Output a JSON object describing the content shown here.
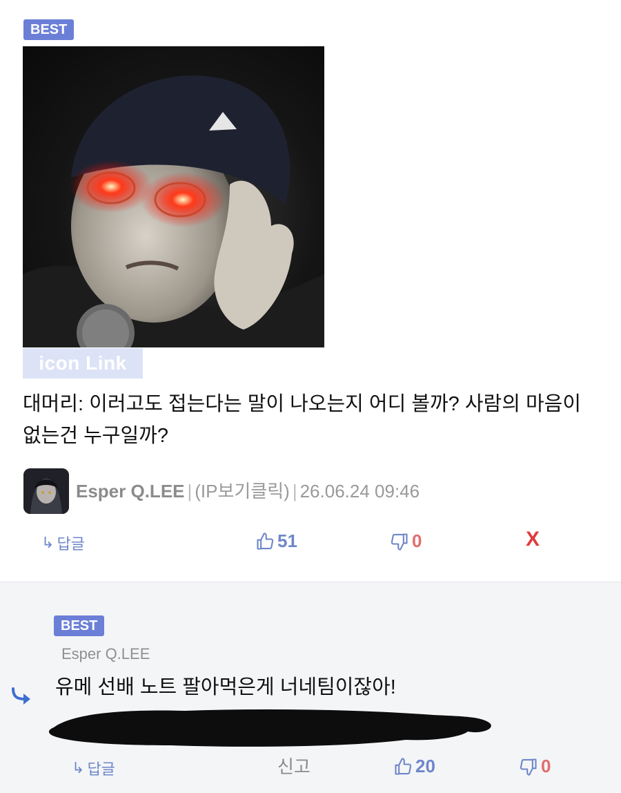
{
  "comment": {
    "badge": "BEST",
    "image_caption": "icon Link",
    "text": "대머리: 이러고도 접는다는 말이 나오는지 어디 볼까? 사람의 마음이 없는건 누구일까?",
    "author": "Esper Q.LEE",
    "ip_label": "(IP보기클릭)",
    "timestamp": "26.06.24 09:46",
    "reply_label": "답글",
    "likes": "51",
    "dislikes": "0",
    "delete_label": "X"
  },
  "reply": {
    "badge": "BEST",
    "author": "Esper Q.LEE",
    "text": "유메 선배 노트 팔아먹은게 너네팀이잖아!",
    "reply_label": "답글",
    "report_label": "신고",
    "likes": "20",
    "dislikes": "0"
  },
  "icons": {
    "reply": "reply-arrow-icon",
    "like": "thumbs-up-icon",
    "dislike": "thumbs-down-icon"
  },
  "colors": {
    "badge": "#6b7fd7",
    "like": "#6e86c9",
    "dislike": "#e26d6d",
    "delete": "#e03b3b",
    "reply_bg": "#f4f5f7"
  }
}
